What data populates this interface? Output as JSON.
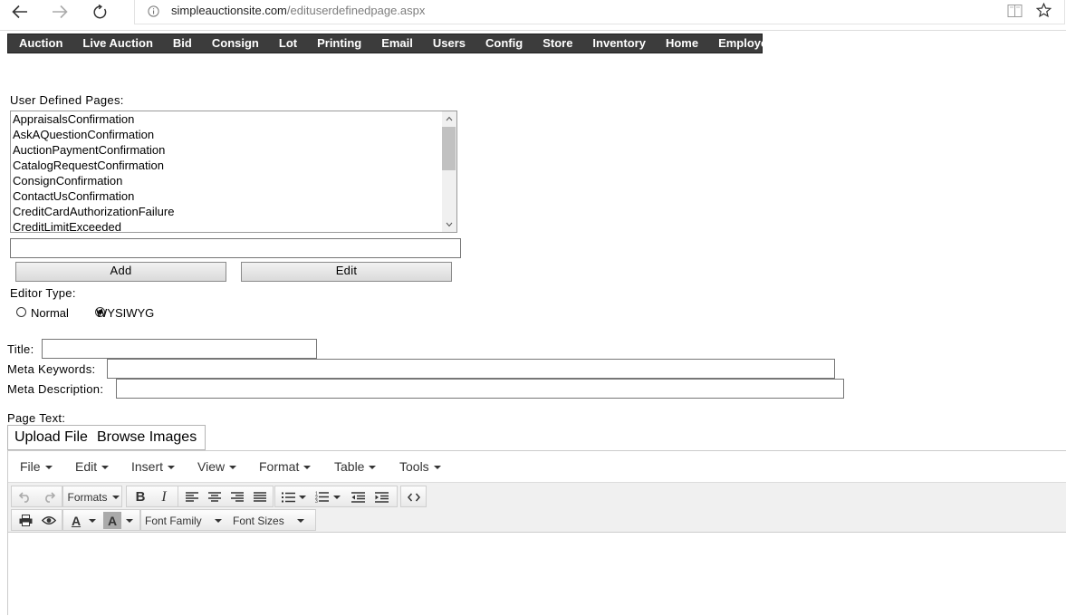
{
  "browser": {
    "url_host": "simpleauctionsite.com",
    "url_path": "/edituserdefinedpage.aspx",
    "back_icon": "arrow-left-icon",
    "forward_icon": "arrow-right-icon",
    "refresh_icon": "refresh-icon",
    "info_icon": "info-icon",
    "reading_icon": "book-icon",
    "favorite_icon": "star-icon"
  },
  "top_menu": [
    "Auction",
    "Live Auction",
    "Bid",
    "Consign",
    "Lot",
    "Printing",
    "Email",
    "Users",
    "Config",
    "Store",
    "Inventory",
    "Home",
    "Employees"
  ],
  "user_defined_pages": {
    "label": "User Defined Pages:",
    "items": [
      "AppraisalsConfirmation",
      "AskAQuestionConfirmation",
      "AuctionPaymentConfirmation",
      "CatalogRequestConfirmation",
      "ConsignConfirmation",
      "ContactUsConfirmation",
      "CreditCardAuthorizationFailure",
      "CreditLimitExceeded"
    ],
    "new_page_value": "",
    "add_label": "Add",
    "edit_label": "Edit"
  },
  "editor_type": {
    "label": "Editor Type:",
    "options": [
      "Normal",
      "WYSIWYG"
    ],
    "selected": "WYSIWYG"
  },
  "fields": {
    "title_label": "Title:",
    "title_value": "",
    "meta_keywords_label": "Meta Keywords:",
    "meta_keywords_value": "",
    "meta_description_label": "Meta Description:",
    "meta_description_value": ""
  },
  "page_text": {
    "label": "Page Text:",
    "upload_label": "Upload File",
    "browse_label": "Browse Images"
  },
  "editor": {
    "menus": [
      "File",
      "Edit",
      "Insert",
      "View",
      "Format",
      "Table",
      "Tools"
    ],
    "formats_label": "Formats",
    "font_family_label": "Font Family",
    "font_sizes_label": "Font Sizes",
    "bold_label": "B",
    "italic_label": "I",
    "text_color_label": "A",
    "bg_color_label": "A"
  }
}
